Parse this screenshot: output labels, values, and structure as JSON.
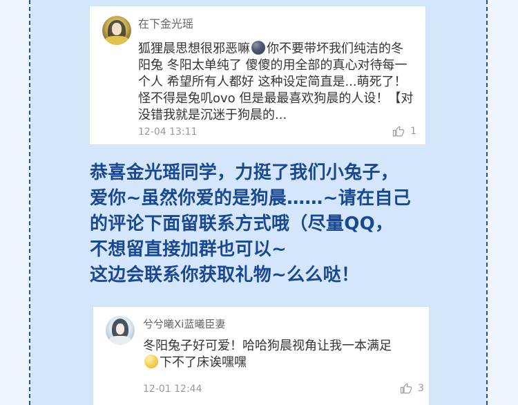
{
  "comments": [
    {
      "username": "在下金光瑶",
      "text_segments": [
        "狐狸晨思想很邪恶嘛",
        "你不要带坏我们纯洁的冬阳兔 冬阳太单纯了 傻傻的用全部的真心对待每一个人 希望所有人都好 这种设定简直是...萌死了！怪不得是兔叽ovo 但是最最喜欢狗晨的人设！【对没错我就是沉迷于狗晨的..."
      ],
      "emoji_icon": "dark-face-emoji-icon",
      "timestamp": "12-04 13:11",
      "likes": "1"
    },
    {
      "username": "兮兮曦Xi蓝曦臣妻",
      "text_segments": [
        "冬阳兔子好可爱！哈哈狗晨视角让我一本满足",
        "下不了床诶嘿嘿"
      ],
      "emoji_icon": "smile-face-emoji-icon",
      "timestamp": "12-01 12:44",
      "likes": "3"
    }
  ],
  "announcement": [
    "恭喜金光瑶同学，力挺了我们小兔子，",
    "爱你~虽然你爱的是狗晨……~请在自己",
    "的评论下面留联系方式哦（尽量QQ，",
    "不想留直接加群也可以~",
    "这边会联系你获取礼物~么么哒！"
  ],
  "colors": {
    "background": "#d4e6fb",
    "border_dashes": "#2a4f93",
    "announcement_text": "#194792",
    "card_background": "#ffffff"
  },
  "icons": {
    "like": "thumb-up-icon",
    "avatar_1": "avatar",
    "avatar_2": "avatar"
  }
}
